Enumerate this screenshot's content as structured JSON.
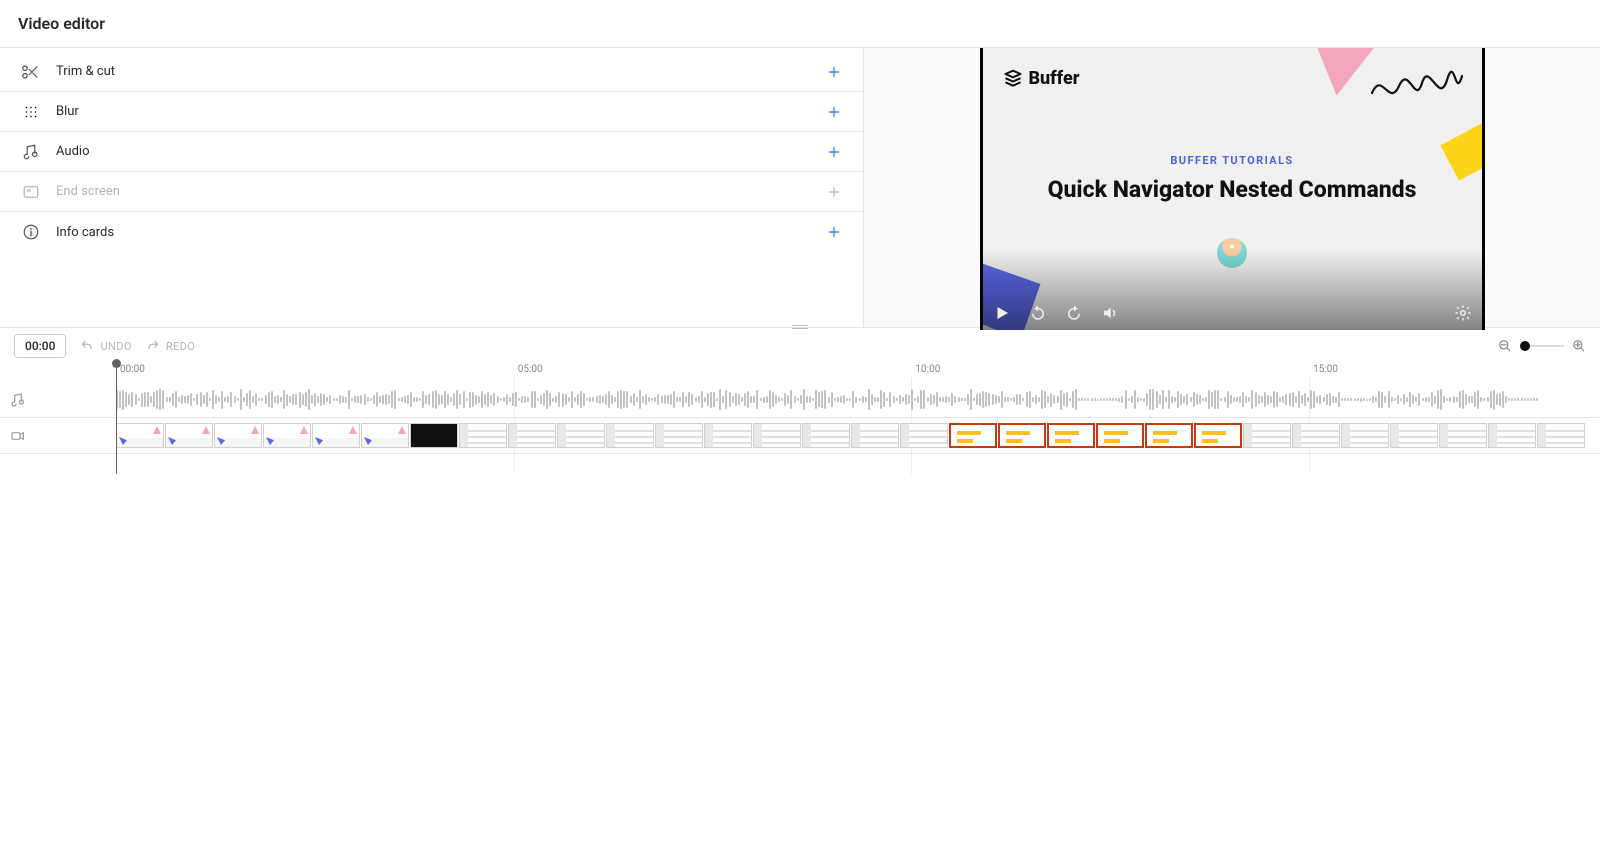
{
  "header": {
    "title": "Video editor"
  },
  "tools": [
    {
      "id": "trim-cut",
      "label": "Trim & cut",
      "disabled": false
    },
    {
      "id": "blur",
      "label": "Blur",
      "disabled": false
    },
    {
      "id": "audio",
      "label": "Audio",
      "disabled": false
    },
    {
      "id": "end-screen",
      "label": "End screen",
      "disabled": true
    },
    {
      "id": "info-cards",
      "label": "Info cards",
      "disabled": false
    }
  ],
  "preview": {
    "brand": "Buffer",
    "subtitle": "BUFFER TUTORIALS",
    "title": "Quick Navigator Nested Commands"
  },
  "toolbar": {
    "current_time": "00:00",
    "undo_label": "UNDO",
    "redo_label": "REDO"
  },
  "timeline": {
    "ruler": [
      {
        "t": "00:00",
        "pos_pct": 0
      },
      {
        "t": "05:00",
        "pos_pct": 26.8
      },
      {
        "t": "10:00",
        "pos_pct": 53.6
      },
      {
        "t": "15:00",
        "pos_pct": 80.4
      }
    ],
    "tracks": [
      "audio",
      "video"
    ],
    "video_thumb_count": 30
  }
}
